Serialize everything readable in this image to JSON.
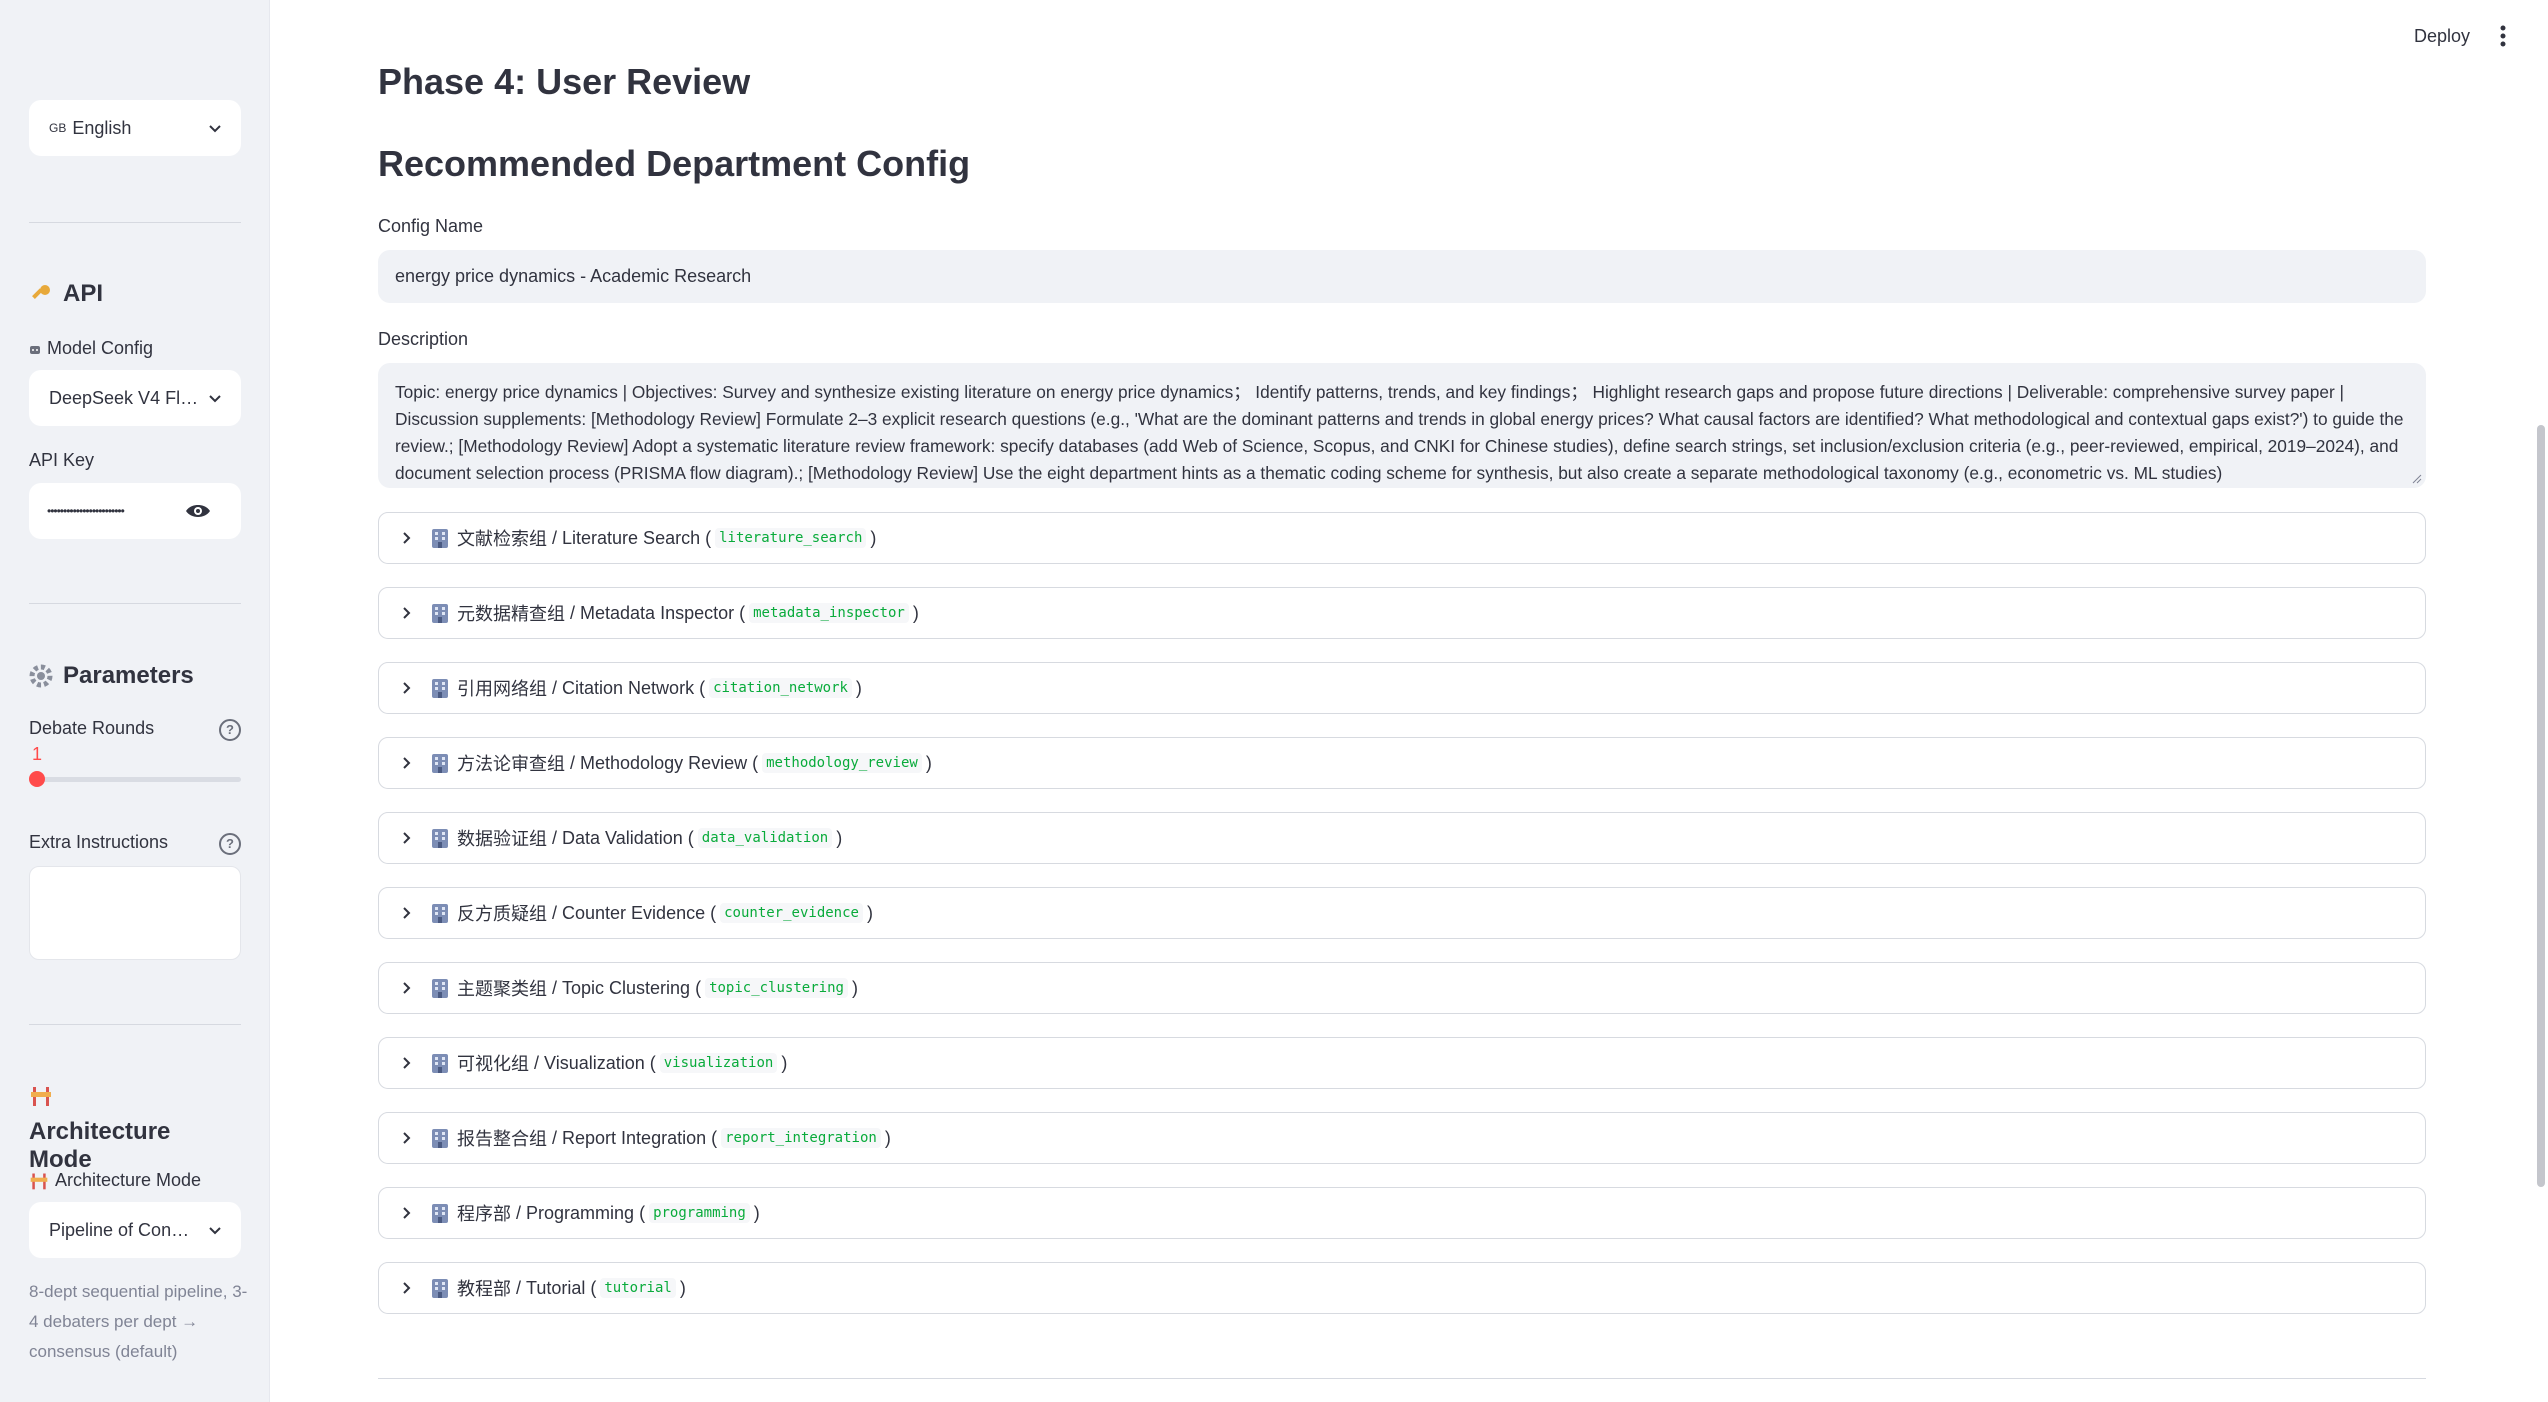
{
  "sidebar": {
    "language": {
      "flag": "GB",
      "value": "English"
    },
    "api": {
      "heading": "API",
      "model_config_label": "Model Config",
      "model_config_value": "DeepSeek V4 Fl…",
      "api_key_label": "API Key",
      "api_key_value": "••••••••••••••••••••••••"
    },
    "parameters": {
      "heading": "Parameters",
      "debate_rounds_label": "Debate Rounds",
      "debate_rounds_value": "1",
      "debate_rounds_fraction": 0,
      "extra_instructions_label": "Extra Instructions",
      "extra_instructions_value": ""
    },
    "architecture": {
      "heading": "Architecture Mode",
      "mode_label": "Architecture Mode",
      "mode_value": "Pipeline of Con…",
      "caption": "8-dept sequential pipeline, 3-4 debaters per dept → consensus (default)"
    }
  },
  "header": {
    "deploy_label": "Deploy"
  },
  "main": {
    "phase_title": "Phase 4: User Review",
    "section_title": "Recommended Department Config",
    "config_name_label": "Config Name",
    "config_name_value": "energy price dynamics - Academic Research",
    "description_label": "Description",
    "description_value": "Topic: energy price dynamics | Objectives: Survey and synthesize existing literature on energy price dynamics；  Identify patterns, trends, and key findings；  Highlight research gaps and propose future directions | Deliverable: comprehensive survey paper | Discussion supplements: [Methodology Review] Formulate 2–3 explicit research questions (e.g., 'What are the dominant patterns and trends in global energy prices? What causal factors are identified? What methodological and contextual gaps exist?') to guide the review.; [Methodology Review] Adopt a systematic literature review framework: specify databases (add Web of Science, Scopus, and CNKI for Chinese studies), define search strings, set inclusion/exclusion criteria (e.g., peer-reviewed, empirical, 2019–2024), and document selection process (PRISMA flow diagram).; [Methodology Review] Use the eight department hints as a thematic coding scheme for synthesis, but also create a separate methodological taxonomy (e.g., econometric vs. ML studies)",
    "departments": [
      {
        "zh": "文献检索组",
        "en": "Literature Search",
        "key": "literature_search"
      },
      {
        "zh": "元数据精查组",
        "en": "Metadata Inspector",
        "key": "metadata_inspector"
      },
      {
        "zh": "引用网络组",
        "en": "Citation Network",
        "key": "citation_network"
      },
      {
        "zh": "方法论审查组",
        "en": "Methodology Review",
        "key": "methodology_review"
      },
      {
        "zh": "数据验证组",
        "en": "Data Validation",
        "key": "data_validation"
      },
      {
        "zh": "反方质疑组",
        "en": "Counter Evidence",
        "key": "counter_evidence"
      },
      {
        "zh": "主题聚类组",
        "en": "Topic Clustering",
        "key": "topic_clustering"
      },
      {
        "zh": "可视化组",
        "en": "Visualization",
        "key": "visualization"
      },
      {
        "zh": "报告整合组",
        "en": "Report Integration",
        "key": "report_integration"
      },
      {
        "zh": "程序部",
        "en": "Programming",
        "key": "programming"
      },
      {
        "zh": "教程部",
        "en": "Tutorial",
        "key": "tutorial"
      }
    ]
  },
  "colors": {
    "accent": "#ff4b4b",
    "code_green": "#09ab3b",
    "sidebar_bg": "#f0f2f6"
  }
}
